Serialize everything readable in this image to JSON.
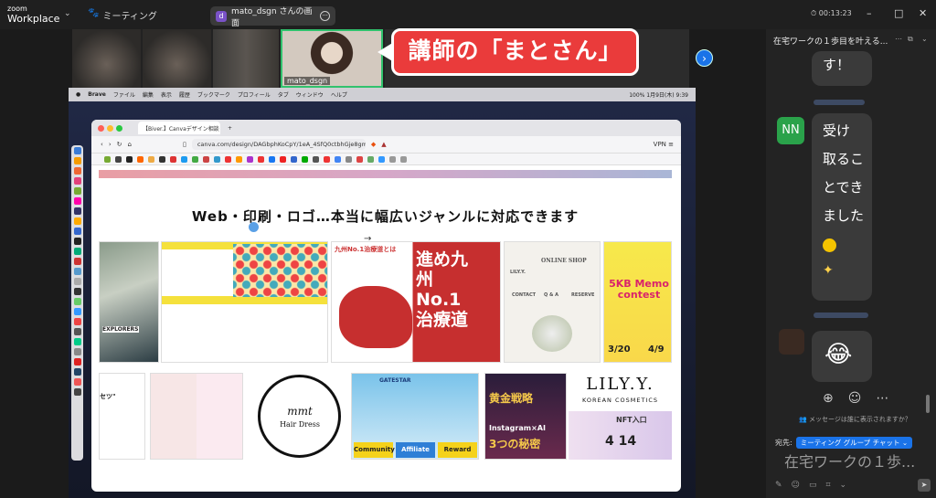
{
  "app": {
    "brand_small": "zoom",
    "brand_big": "Workplace",
    "meeting_label": "ミーティング",
    "share_title": "mato_dsgn さんの画面",
    "share_avatar": "d",
    "timer": "00:13:23",
    "win_min": "–",
    "win_max": "□",
    "win_close": "✕"
  },
  "video": {
    "speaker_name": "mato_dsgn",
    "callout": "講師の「まとさん」",
    "next": "›"
  },
  "mac": {
    "apple": "",
    "app": "Brave",
    "menus": [
      "ファイル",
      "編集",
      "表示",
      "履歴",
      "ブックマーク",
      "プロフィール",
      "タブ",
      "ウィンドウ",
      "ヘルプ"
    ],
    "battery": "100%",
    "date": "1月9日(木) 9:39"
  },
  "browser": {
    "tab": "【Biver.】Canvaデザイン相談",
    "url": "canva.com/design/DAGbphKoCpY/1eA_4SfQ0ctbhGje8gm...",
    "vpn": "VPN"
  },
  "canvas": {
    "heading": "Web・印刷・ロゴ…本当に幅広いジャンルに対応できます",
    "arrow": "→",
    "t_kyushu_top": "九州No.1治療道とは",
    "t_kyushu": "進め九州No.1治療道",
    "t_shop": "ONLINE SHOP",
    "t_lily_small": "LILY.Y.",
    "t_contact": "CONTACT",
    "t_qa": "Q & A",
    "t_reserve": "RESERVE",
    "t_memo": "5KB Memo contest",
    "t_date1": "3/20",
    "t_date2": "4/9",
    "t_explore": "EXPLORERS",
    "t_setsu": "セツ\"",
    "t_hair": "Hair Dress",
    "t_mmt": "mmt",
    "t_gatestar": "GATESTAR",
    "t_community": "Community",
    "t_affiliate": "Affiliate",
    "t_reward": "Reward",
    "t_gold": "黄金戦略",
    "t_insta": "Instagram×AI",
    "t_three": "3つの秘密",
    "t_lily": "LILY.Y.",
    "t_korean": "KOREAN COSMETICS",
    "t_nft": "NFT入口",
    "t_414": "4 14"
  },
  "chat": {
    "title": "在宅ワークの１歩目を叶える...",
    "prev_tail": "す！",
    "avatar": "NN",
    "lines": [
      "受け",
      "取るこ",
      "とでき",
      "ました"
    ],
    "reply": "😂",
    "who_sees": "メッセージは誰に表示されますか？",
    "to_label": "宛先:",
    "to_value": "ミーティング グループ チャット",
    "draft": "在宅ワークの１歩...",
    "send": "➤"
  }
}
